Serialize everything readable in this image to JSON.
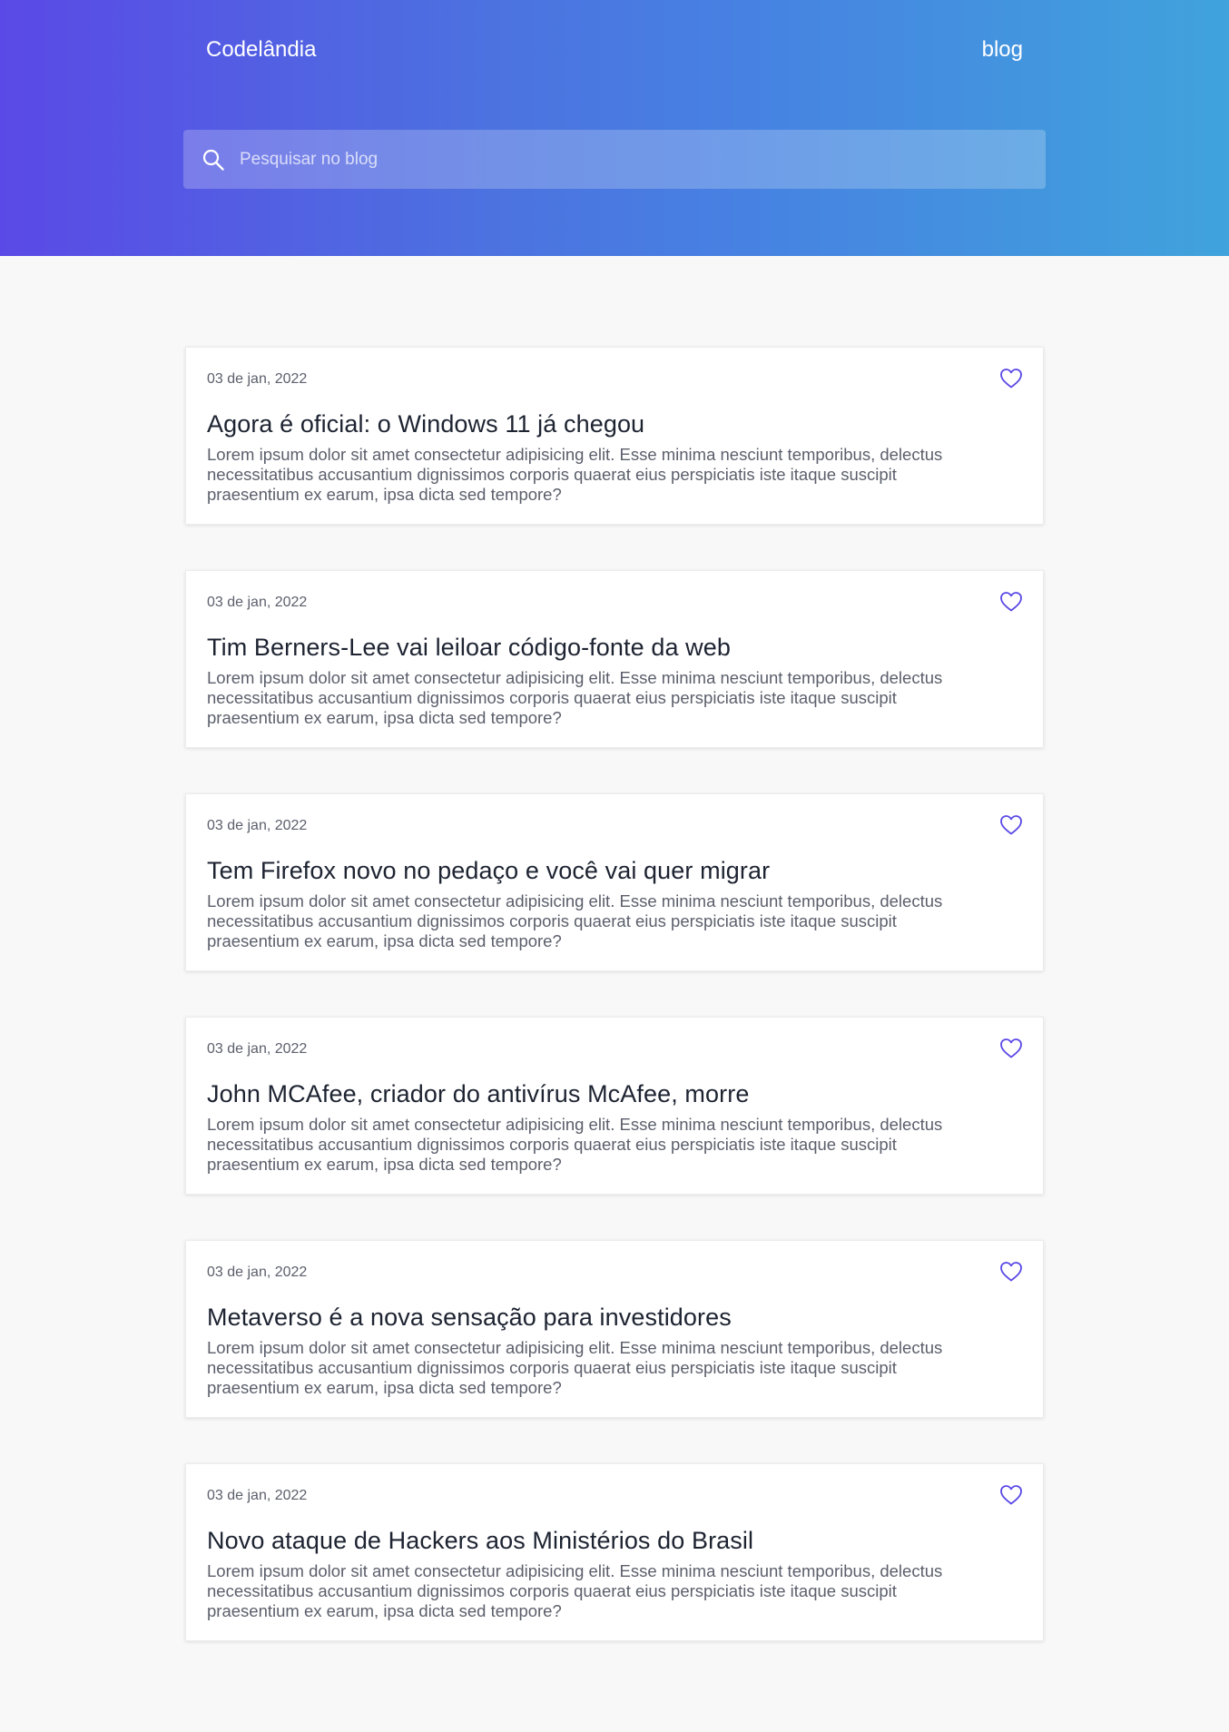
{
  "header": {
    "brand": "Codelândia",
    "nav_link": "blog",
    "search_placeholder": "Pesquisar no blog",
    "search_value": ""
  },
  "colors": {
    "gradient_start": "#5a49e6",
    "gradient_end": "#40a3dc",
    "accent": "#5a49e6",
    "background": "#f8f8f8"
  },
  "posts": [
    {
      "date": "03 de jan, 2022",
      "title": "Agora é oficial: o Windows 11 já chegou",
      "excerpt": "Lorem ipsum dolor sit amet consectetur adipisicing elit. Esse minima nesciunt temporibus, delectus necessitatibus accusantium dignissimos corporis quaerat eius perspiciatis iste itaque suscipit praesentium ex earum, ipsa dicta sed tempore?",
      "icon": "heart-icon"
    },
    {
      "date": "03 de jan, 2022",
      "title": "Tim Berners-Lee vai leiloar código-fonte da web",
      "excerpt": "Lorem ipsum dolor sit amet consectetur adipisicing elit. Esse minima nesciunt temporibus, delectus necessitatibus accusantium dignissimos corporis quaerat eius perspiciatis iste itaque suscipit praesentium ex earum, ipsa dicta sed tempore?",
      "icon": "heart-icon"
    },
    {
      "date": "03 de jan, 2022",
      "title": "Tem Firefox novo no pedaço e você vai quer migrar",
      "excerpt": "Lorem ipsum dolor sit amet consectetur adipisicing elit. Esse minima nesciunt temporibus, delectus necessitatibus accusantium dignissimos corporis quaerat eius perspiciatis iste itaque suscipit praesentium ex earum, ipsa dicta sed tempore?",
      "icon": "heart-icon"
    },
    {
      "date": "03 de jan, 2022",
      "title": "John MCAfee, criador do antivírus McAfee, morre",
      "excerpt": "Lorem ipsum dolor sit amet consectetur adipisicing elit. Esse minima nesciunt temporibus, delectus necessitatibus accusantium dignissimos corporis quaerat eius perspiciatis iste itaque suscipit praesentium ex earum, ipsa dicta sed tempore?",
      "icon": "heart-icon"
    },
    {
      "date": "03 de jan, 2022",
      "title": "Metaverso é a nova sensação para investidores",
      "excerpt": "Lorem ipsum dolor sit amet consectetur adipisicing elit. Esse minima nesciunt temporibus, delectus necessitatibus accusantium dignissimos corporis quaerat eius perspiciatis iste itaque suscipit praesentium ex earum, ipsa dicta sed tempore?",
      "icon": "heart-icon"
    },
    {
      "date": "03 de jan, 2022",
      "title": "Novo ataque de Hackers aos Ministérios do Brasil",
      "excerpt": "Lorem ipsum dolor sit amet consectetur adipisicing elit. Esse minima nesciunt temporibus, delectus necessitatibus accusantium dignissimos corporis quaerat eius perspiciatis iste itaque suscipit praesentium ex earum, ipsa dicta sed tempore?",
      "icon": "heart-icon"
    }
  ]
}
